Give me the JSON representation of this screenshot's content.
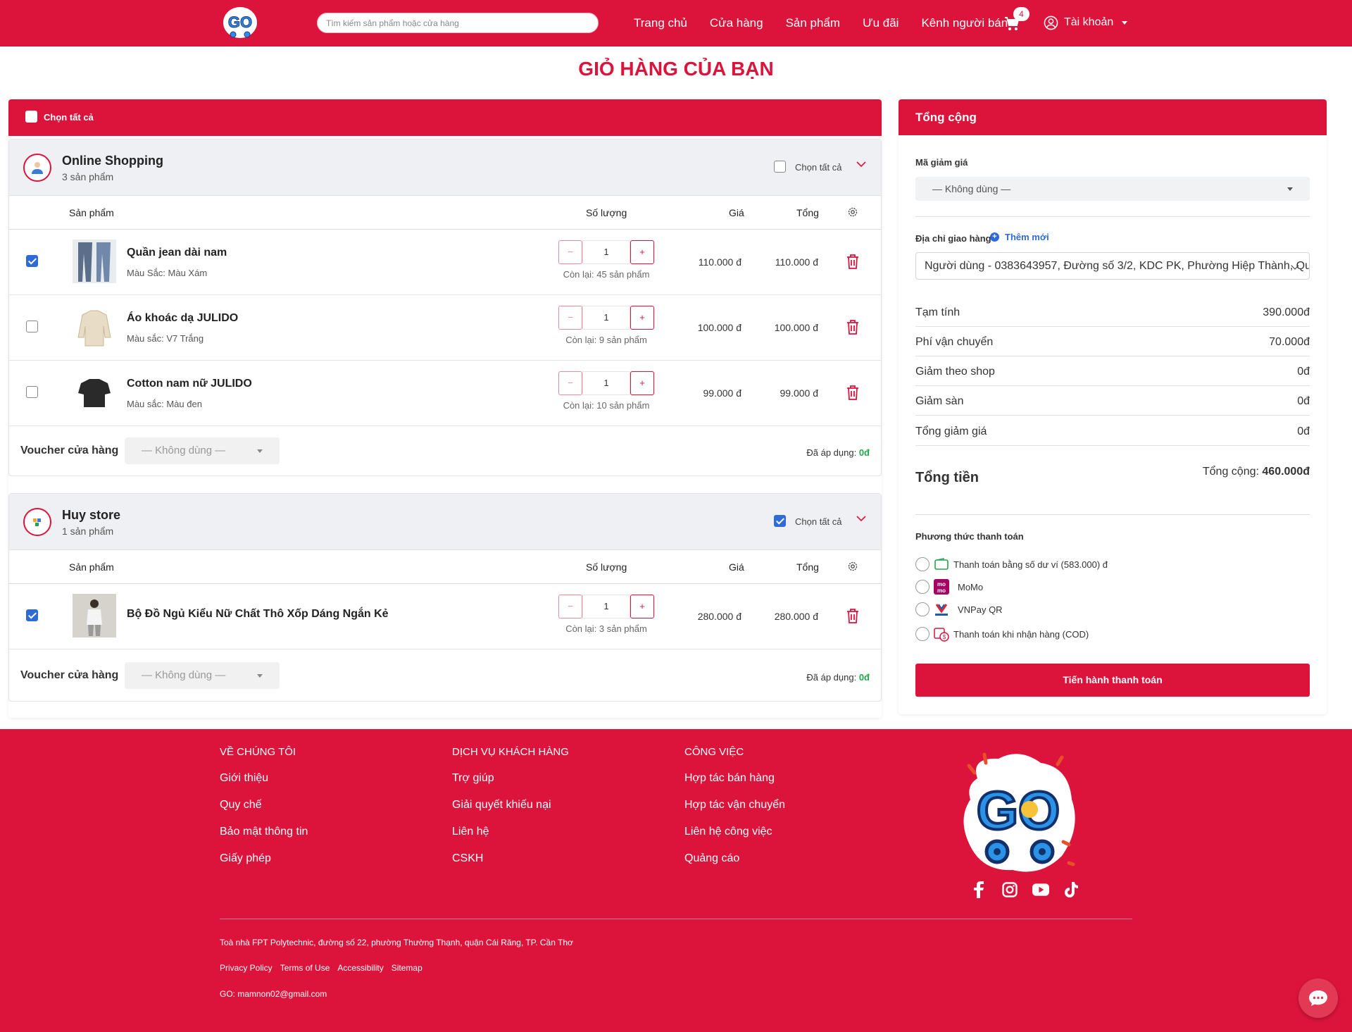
{
  "header": {
    "search_placeholder": "Tìm kiếm sản phẩm hoặc cửa hàng",
    "nav": [
      "Trang chủ",
      "Cửa hàng",
      "Sản phẩm",
      "Ưu đãi",
      "Kênh người bán"
    ],
    "cart_count": "4",
    "account_label": "Tài khoản"
  },
  "page_title": "GIỎ HÀNG CỦA BẠN",
  "cart": {
    "select_all_label": "Chọn tất cả",
    "columns": {
      "product": "Sản phẩm",
      "quantity": "Số lượng",
      "price": "Giá",
      "total": "Tổng"
    },
    "voucher_label": "Voucher cửa hàng",
    "voucher_value": "— Không dùng —",
    "applied_label": "Đã áp dụng:",
    "applied_value": "0đ",
    "shops": [
      {
        "name": "Online Shopping",
        "count": "3 sản phẩm",
        "select_all": "Chọn tất cả",
        "items": [
          {
            "name": "Quần jean dài nam",
            "variant": "Màu Sắc: Màu Xám",
            "qty": "1",
            "stock": "Còn lại: 45 sản phẩm",
            "price": "110.000 đ",
            "total": "110.000 đ",
            "checked": true
          },
          {
            "name": "Áo khoác dạ JULIDO",
            "variant": "Màu sắc: V7 Trắng",
            "qty": "1",
            "stock": "Còn lại: 9 sản phẩm",
            "price": "100.000 đ",
            "total": "100.000 đ",
            "checked": false
          },
          {
            "name": "Cotton nam nữ JULIDO",
            "variant": "Màu sắc: Màu đen",
            "qty": "1",
            "stock": "Còn lại: 10 sản phẩm",
            "price": "99.000 đ",
            "total": "99.000 đ",
            "checked": false
          }
        ]
      },
      {
        "name": "Huy store",
        "count": "1 sản phẩm",
        "select_all": "Chọn tất cả",
        "items": [
          {
            "name": "Bộ Đồ Ngủ Kiểu Nữ Chất Thô Xốp Dáng Ngắn Kẻ",
            "variant": "",
            "qty": "1",
            "stock": "Còn lại: 3 sản phẩm",
            "price": "280.000 đ",
            "total": "280.000 đ",
            "checked": true
          }
        ]
      }
    ]
  },
  "summary": {
    "title": "Tổng cộng",
    "discount_code_label": "Mã giảm giá",
    "discount_code_value": "— Không dùng —",
    "address_label": "Địa chỉ giao hàng",
    "add_new": "Thêm mới",
    "address_value": "Người dùng - 0383643957, Đường số 3/2, KDC PK, Phường Hiệp Thành, Quận Ninh Kiều",
    "rows": [
      {
        "k": "Tạm tính",
        "v": "390.000đ"
      },
      {
        "k": "Phí vận chuyển",
        "v": "70.000đ"
      },
      {
        "k": "Giảm theo shop",
        "v": "0đ"
      },
      {
        "k": "Giảm sàn",
        "v": "0đ"
      },
      {
        "k": "Tổng giảm giá",
        "v": "0đ"
      }
    ],
    "total_label": "Tổng tiền",
    "total_prefix": "Tổng cộng:",
    "total_value": "460.000đ",
    "payment_label": "Phương thức thanh toán",
    "payments": [
      "Thanh toán bằng số dư ví (583.000) đ",
      "MoMo",
      "VNPay QR",
      "Thanh toán khi nhận hàng (COD)"
    ],
    "checkout_label": "Tiến hành thanh toán"
  },
  "footer": {
    "col1": {
      "title": "VỀ CHÚNG TÔI",
      "links": [
        "Giới thiệu",
        "Quy chế",
        "Bảo mật thông tin",
        "Giấy phép"
      ]
    },
    "col2": {
      "title": "DỊCH VỤ KHÁCH HÀNG",
      "links": [
        "Trợ giúp",
        "Giải quyết khiếu nại",
        "Liên hệ",
        "CSKH"
      ]
    },
    "col3": {
      "title": "CÔNG VIỆC",
      "links": [
        "Hợp tác bán hàng",
        "Hợp tác vận chuyển",
        "Liên hệ công việc",
        "Quảng cáo"
      ]
    },
    "address": "Toà nhà FPT Polytechnic, đường số 22, phường Thường Thạnh, quận Cái Răng, TP. Cần Thơ",
    "links": [
      "Privacy Policy",
      "Terms of Use",
      "Accessibility",
      "Sitemap"
    ],
    "email": "GO: mamnon02@gmail.com",
    "logo_text": "GO"
  },
  "colors": {
    "brand": "#dc143c",
    "link_blue": "#2f6bd8",
    "applied_green": "#22a84a"
  },
  "icons": [
    "cart-icon",
    "user-icon",
    "gear-icon",
    "trash-icon",
    "facebook-icon",
    "instagram-icon",
    "youtube-icon",
    "tiktok-icon",
    "chat-icon"
  ]
}
